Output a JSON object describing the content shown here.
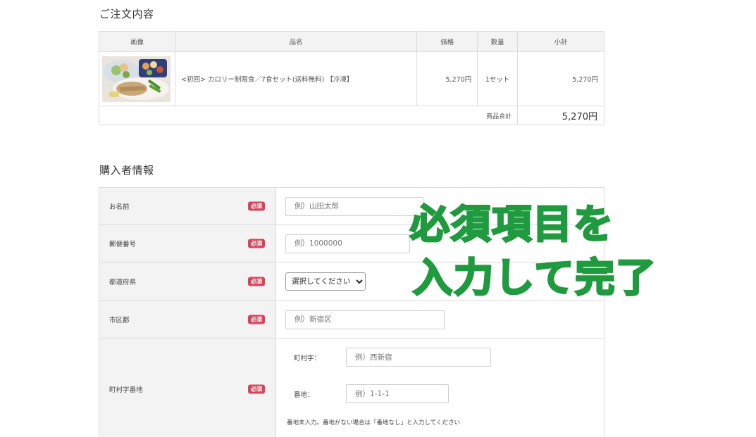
{
  "order": {
    "title": "ご注文内容",
    "headers": {
      "image": "画像",
      "name": "品名",
      "price": "価格",
      "qty": "数量",
      "subtotal": "小計"
    },
    "item": {
      "name": "<初回> カロリー制限食／7食セット(送料無料) 【冷凍】",
      "price": "5,270円",
      "qty": "1セット",
      "subtotal": "5,270円"
    },
    "sum_label": "商品合計",
    "sum_value": "5,270円"
  },
  "buyer": {
    "title": "購入者情報",
    "required_badge": "必須",
    "name": {
      "label": "お名前",
      "placeholder": "例）山田太郎"
    },
    "zip": {
      "label": "郵便番号",
      "placeholder": "例）1000000"
    },
    "pref": {
      "label": "都道府県",
      "selected": "選択してください"
    },
    "city": {
      "label": "市区郡",
      "placeholder": "例）新宿区"
    },
    "address": {
      "label": "町村字番地",
      "town_label": "町村字：",
      "town_placeholder": "例）西新宿",
      "number_label": "番地：",
      "number_placeholder": "例）1-1-1",
      "note": "番地未入力。番地がない場合は「番地なし」と入力してください"
    }
  },
  "overlay": {
    "line1": "必須項目を",
    "line2": "入力して完了",
    "color": "#2bb24c"
  }
}
